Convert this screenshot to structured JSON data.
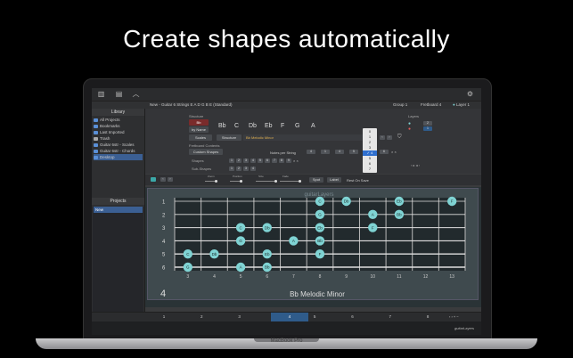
{
  "headline": "Create shapes automatically",
  "device_label": "MacBook Pro",
  "titlebar": {
    "tuning": "New - Guitar 6 Strings E A D G B E (Standard)",
    "group": "Group 1",
    "fretboard": "Fretboard 4",
    "layer": "Layer 1"
  },
  "sidebar": {
    "library_header": "Library",
    "items": [
      {
        "label": "All Projects"
      },
      {
        "label": "Bookmarks"
      },
      {
        "label": "Last Imported"
      },
      {
        "label": "Trash"
      },
      {
        "label": "Guitar 6str - Scales"
      },
      {
        "label": "Guitar 6str - Chords"
      },
      {
        "label": "Desktop"
      }
    ],
    "projects_header": "Projects",
    "project_item": "New"
  },
  "controls": {
    "structure_label": "Structure",
    "root_note": "Bb",
    "by_name": "by Name",
    "notes": [
      "Bb",
      "C",
      "Db",
      "Eb",
      "F",
      "G",
      "A"
    ],
    "scales_btn": "Scales",
    "structure_btn": "Structure",
    "structure_value": "Bb Melodic Minor",
    "fretboard_contents": "Fretboard Contents",
    "custom_shapes": "Custom Shapes",
    "notes_per_string": "Notes per String",
    "shapes_label": "Shapes",
    "sub_shapes_label": "Sub-Shapes",
    "nps_values": [
      "4",
      "1",
      "4",
      "5",
      "6"
    ],
    "shape_numbers": [
      "1",
      "2",
      "3",
      "4",
      "5",
      "6",
      "7",
      "8",
      "9"
    ],
    "sub_shape_numbers": [
      "1",
      "2",
      "3",
      "4"
    ],
    "dropdown_items": [
      "0",
      "1",
      "2",
      "3",
      "4",
      "5",
      "6",
      "7"
    ],
    "dropdown_selected": "4",
    "layers_label": "Layers",
    "layer_values": [
      "1",
      "2"
    ],
    "slider_labels": [
      "Zoom",
      "Position",
      "Size",
      "Fade"
    ],
    "buttons": [
      "Spot",
      "Label",
      "Rest On Save"
    ]
  },
  "fretboard": {
    "watermark": "guitarLayers",
    "position_number": "4",
    "caption": "Bb Melodic Minor",
    "strings": [
      "1",
      "2",
      "3",
      "4",
      "5",
      "6"
    ],
    "fret_numbers": [
      "3",
      "4",
      "5",
      "6",
      "7",
      "8",
      "9",
      "10",
      "11",
      "12",
      "13"
    ],
    "dots": [
      {
        "string": 1,
        "fret": 8,
        "note": "C"
      },
      {
        "string": 1,
        "fret": 9,
        "note": "Db"
      },
      {
        "string": 1,
        "fret": 11,
        "note": "Eb"
      },
      {
        "string": 1,
        "fret": 13,
        "note": "F"
      },
      {
        "string": 2,
        "fret": 8,
        "note": "G"
      },
      {
        "string": 2,
        "fret": 10,
        "note": "A"
      },
      {
        "string": 2,
        "fret": 11,
        "note": "Bb"
      },
      {
        "string": 3,
        "fret": 5,
        "note": "C"
      },
      {
        "string": 3,
        "fret": 6,
        "note": "Db"
      },
      {
        "string": 3,
        "fret": 8,
        "note": "Eb"
      },
      {
        "string": 3,
        "fret": 10,
        "note": "F"
      },
      {
        "string": 4,
        "fret": 5,
        "note": "G"
      },
      {
        "string": 4,
        "fret": 7,
        "note": "A"
      },
      {
        "string": 4,
        "fret": 8,
        "note": "Bb"
      },
      {
        "string": 5,
        "fret": 3,
        "note": "C"
      },
      {
        "string": 5,
        "fret": 4,
        "note": "Db"
      },
      {
        "string": 5,
        "fret": 6,
        "note": "Eb"
      },
      {
        "string": 5,
        "fret": 8,
        "note": "F"
      },
      {
        "string": 6,
        "fret": 3,
        "note": "G"
      },
      {
        "string": 6,
        "fret": 5,
        "note": "A"
      },
      {
        "string": 6,
        "fret": 6,
        "note": "Bb"
      }
    ]
  },
  "pagination": {
    "pages": [
      "1",
      "2",
      "3",
      "4",
      "5",
      "6",
      "7",
      "8"
    ],
    "active": "4"
  },
  "colors": {
    "dot_fill": "#7fd3d3",
    "dot_text": "#1a2a2a",
    "active_blue": "#2f5b8a"
  }
}
